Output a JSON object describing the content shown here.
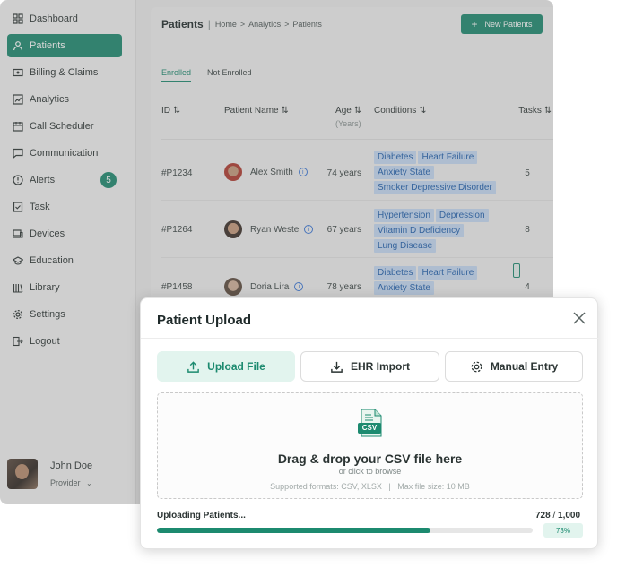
{
  "sidebar": {
    "items": [
      {
        "label": "Dashboard",
        "icon": "dashboard-icon"
      },
      {
        "label": "Patients",
        "icon": "patients-icon",
        "active": true
      },
      {
        "label": "Billing & Claims",
        "icon": "billing-icon"
      },
      {
        "label": "Analytics",
        "icon": "analytics-icon"
      },
      {
        "label": "Call Scheduler",
        "icon": "calendar-icon"
      },
      {
        "label": "Communication",
        "icon": "chat-icon"
      },
      {
        "label": "Alerts",
        "icon": "alert-icon",
        "badge": "5"
      },
      {
        "label": "Task",
        "icon": "task-icon"
      },
      {
        "label": "Devices",
        "icon": "devices-icon"
      },
      {
        "label": "Education",
        "icon": "education-icon"
      },
      {
        "label": "Library",
        "icon": "library-icon"
      },
      {
        "label": "Settings",
        "icon": "gear-icon"
      },
      {
        "label": "Logout",
        "icon": "logout-icon"
      }
    ],
    "user": {
      "name": "John Doe",
      "role": "Provider"
    }
  },
  "header": {
    "title": "Patients",
    "breadcrumb": [
      "Home",
      "Analytics",
      "Patients"
    ],
    "new_button": "New Patients"
  },
  "tabs": [
    "Enrolled",
    "Not Enrolled"
  ],
  "table": {
    "columns": {
      "id": "ID",
      "name": "Patient Name",
      "age": "Age",
      "age_sub": "(Years)",
      "conditions": "Conditions",
      "tasks": "Tasks"
    },
    "rows": [
      {
        "id": "#P1234",
        "name": "Alex Smith",
        "age": "74 years",
        "conditions": [
          "Diabetes",
          "Heart Failure",
          "Anxiety State",
          "Smoker Depressive Disorder"
        ],
        "tasks": "5"
      },
      {
        "id": "#P1264",
        "name": "Ryan Weste",
        "age": "67 years",
        "conditions": [
          "Hypertension",
          "Depression",
          "Vitamin D Deficiency",
          "Lung Disease"
        ],
        "tasks": "8"
      },
      {
        "id": "#P1458",
        "name": "Doria Lira",
        "age": "78 years",
        "conditions": [
          "Diabetes",
          "Heart Failure",
          "Anxiety State"
        ],
        "tasks": "4"
      }
    ]
  },
  "modal": {
    "title": "Patient Upload",
    "tabs": [
      {
        "label": "Upload File",
        "icon": "upload-icon",
        "active": true
      },
      {
        "label": "EHR Import",
        "icon": "download-icon"
      },
      {
        "label": "Manual Entry",
        "icon": "manual-entry-icon"
      }
    ],
    "drop": {
      "main": "Drag & drop your CSV file here",
      "sub": "or click to browse",
      "formats": "Supported formats: CSV, XLSX",
      "max_size": "Max file size: 10 MB",
      "file_badge": "CSV"
    },
    "progress": {
      "label": "Uploading Patients...",
      "done": "728",
      "total": "1,000",
      "percent_label": "73%",
      "fraction": 0.728
    }
  },
  "colors": {
    "accent": "#1c8a6f",
    "accent_light": "#e2f4ee",
    "chip_bg": "#c6dcf5",
    "chip_text": "#1f5fae"
  }
}
